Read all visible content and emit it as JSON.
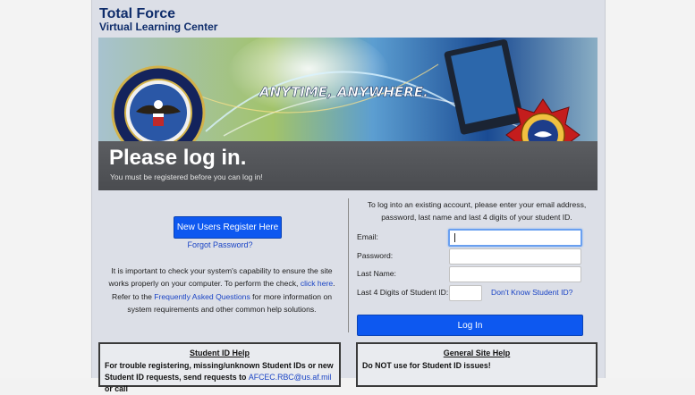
{
  "brand": {
    "line1": "Total Force",
    "line2": "Virtual Learning Center"
  },
  "banner": {
    "slogan": "ANYTIME, ANYWHERE.",
    "title": "Please log in.",
    "subtitle": "You must be registered before you can log in!"
  },
  "left": {
    "register_label": "New Users Register Here",
    "forgot_label": "Forgot Password?",
    "check_before": "It is important to check your system's capability to ensure the site works properly on your computer. To perform the check,",
    "check_link": "click here",
    "check_mid": ". Refer to the",
    "faq_link": "Frequently Asked Questions",
    "check_after": "for more information on system requirements and other common help solutions."
  },
  "form": {
    "intro": "To log into an existing account, please enter your email address, password, last name and last 4 digits of your student ID.",
    "email_label": "Email:",
    "password_label": "Password:",
    "lastname_label": "Last Name:",
    "student_label": "Last 4 Digits of Student ID:",
    "student_link": "Don't Know Student ID?",
    "email_value": "",
    "password_value": "",
    "lastname_value": "",
    "student_value": "",
    "login_label": "Log In"
  },
  "help": {
    "student_title": "Student ID Help",
    "student_body": "For trouble registering, missing/unknown Student IDs or new Student ID requests, send requests to",
    "student_email": "AFCEC.RBC@us.af.mil",
    "student_tail": "or call",
    "general_title": "General Site Help",
    "general_body": "Do NOT use for Student ID issues!"
  },
  "colors": {
    "accent": "#0d58f0",
    "brand": "#0f2d6b",
    "link": "#1a44c5"
  },
  "icons": {
    "left_seal": "dod-seal-icon",
    "right_badge": "fire-emergency-badge-icon"
  }
}
